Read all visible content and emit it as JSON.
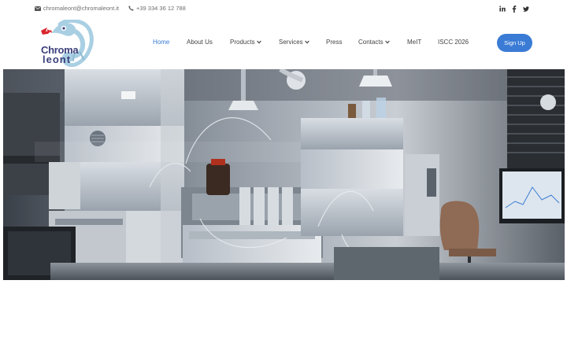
{
  "contact": {
    "email": "chromaleont@chromaleont.it",
    "phone": "+39 334 36 12 788"
  },
  "social": [
    "linkedin-icon",
    "facebook-icon",
    "twitter-icon"
  ],
  "logo": {
    "line1": "Chroma",
    "line2": "leont"
  },
  "nav": {
    "home": "Home",
    "about": "About Us",
    "products": "Products",
    "services": "Services",
    "press": "Press",
    "contacts": "Contacts",
    "meit": "MeIT",
    "iscc": "ISCC 2026",
    "signup": "Sign Up"
  },
  "colors": {
    "accent": "#3a7bd5",
    "text": "#444444",
    "logo_text": "#3b3f7a",
    "logo_chameleon": "#a9cfe3",
    "logo_red": "#d8262e"
  }
}
